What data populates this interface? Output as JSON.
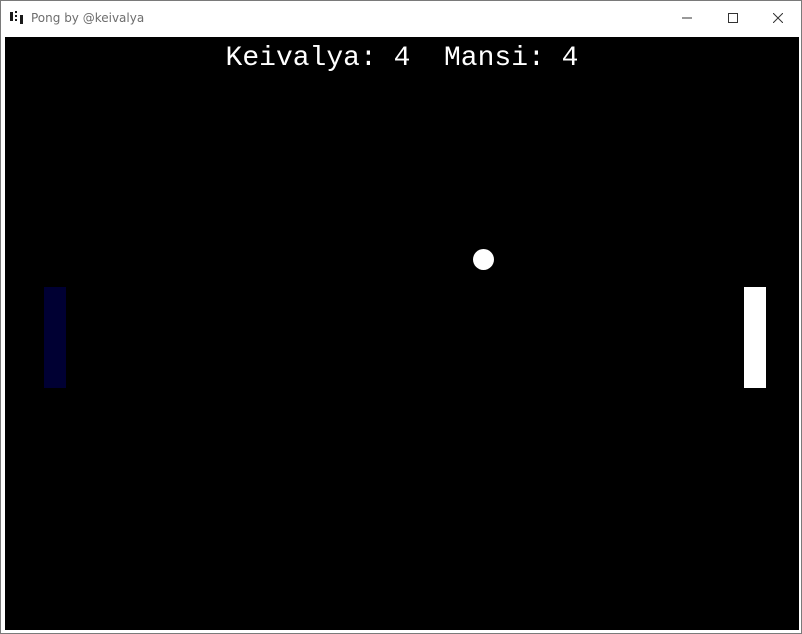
{
  "window": {
    "title": "Pong by @keivalya",
    "icon": "pong-app-icon",
    "controls": {
      "minimize": "minimize-icon",
      "maximize": "maximize-icon",
      "close": "close-icon"
    }
  },
  "score": {
    "player1_name": "Keivalya",
    "player1_score": "4",
    "player2_name": "Mansi",
    "player2_score": "4"
  },
  "colors": {
    "background": "#000000",
    "left_paddle": "#000033",
    "right_paddle": "#ffffff",
    "ball": "#ffffff",
    "text": "#ffffff"
  }
}
